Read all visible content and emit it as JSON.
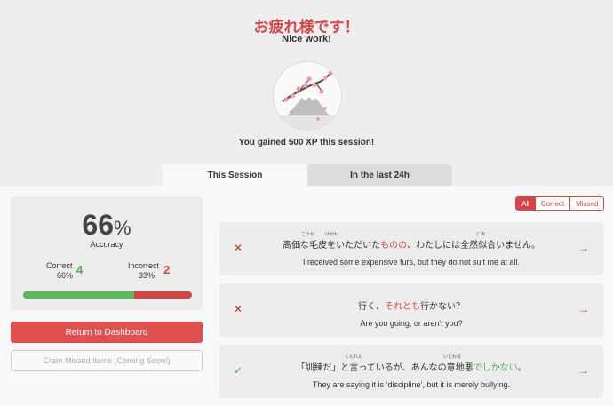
{
  "header": {
    "title": "お疲れ様です！",
    "subtitle": "Nice work!",
    "xp_text": "You gained 500 XP this session!"
  },
  "tabs": [
    {
      "label": "This Session",
      "active": true
    },
    {
      "label": "In the last 24h",
      "active": false
    }
  ],
  "stats": {
    "accuracy_value": "66",
    "accuracy_sign": "%",
    "accuracy_label": "Accuracy",
    "correct_label": "Correct",
    "correct_pct": "66%",
    "correct_count": "4",
    "missed_label": "Incorrect",
    "missed_pct": "33%",
    "missed_count": "2",
    "progress_correct_fraction": 0.66
  },
  "buttons": {
    "return_label": "Return to Dashboard",
    "cram_label": "Cram Missed Items (Coming Soon!)"
  },
  "filters": [
    {
      "label": "All",
      "active": true
    },
    {
      "label": "Correct",
      "active": false
    },
    {
      "label": "Missed",
      "active": false
    }
  ],
  "cards": [
    {
      "result": "missed",
      "mark": "✕",
      "jp_before": "高価な毛皮をいただいた",
      "jp_highlight": "ものの",
      "jp_after": "、わたしには全然似合いません。",
      "furigana": [
        "こうか",
        "けがわ",
        "にあ"
      ],
      "en": "I received some expensive furs, but they do not suit me at all."
    },
    {
      "result": "missed",
      "mark": "✕",
      "jp_before": "行く、",
      "jp_highlight": "それとも",
      "jp_after": "行かない？",
      "furigana": [],
      "en": "Are you going, or aren't you?"
    },
    {
      "result": "correct",
      "mark": "✓",
      "jp_before": "「訓練だ」と言っているが、あんなの意地悪",
      "jp_highlight": "でしかない",
      "jp_after": "。",
      "furigana": [
        "くんれん",
        "いじわる"
      ],
      "en": "They are saying it is ‘discipline’, but it is merely bullying."
    }
  ],
  "colors": {
    "accent": "#d64545",
    "correct": "#4caf50",
    "button": "#e05050"
  },
  "icons": {
    "missed": "close-icon",
    "correct": "check-icon",
    "open": "arrow-right-icon"
  }
}
